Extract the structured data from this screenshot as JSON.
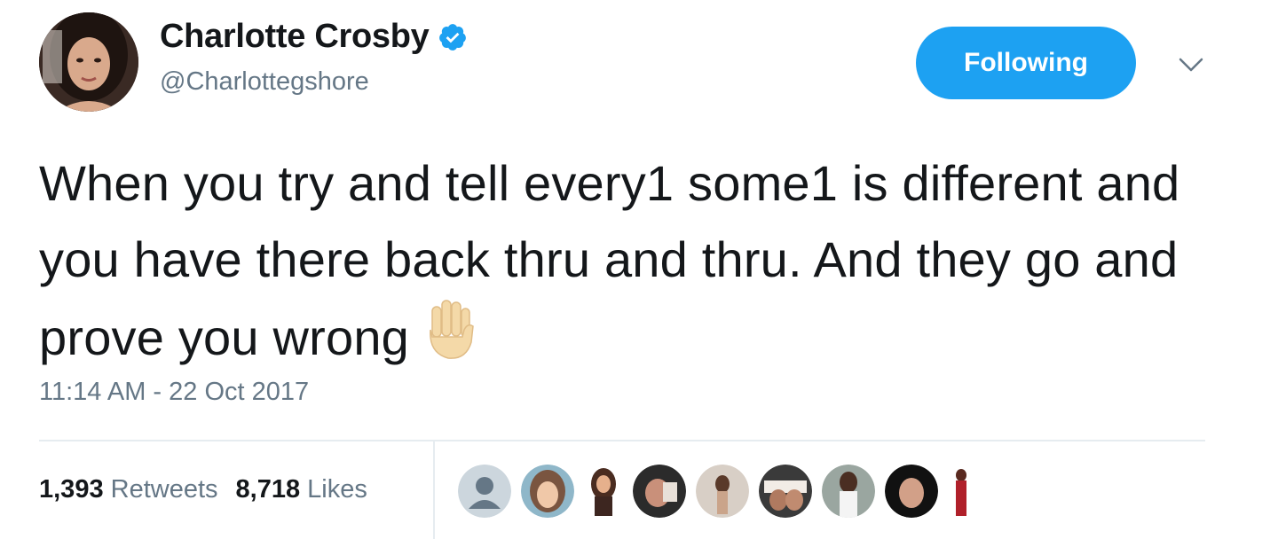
{
  "tweet": {
    "author": {
      "display_name": "Charlotte Crosby",
      "handle": "@Charlottegshore",
      "verified": true,
      "verified_icon": "verified-badge-icon"
    },
    "follow_button_label": "Following",
    "menu_icon": "chevron-down-icon",
    "text": "When you try and tell every1 some1 is different and you have there back thru and thru. And they go and prove you wrong",
    "emoji": "raised-hand-emoji",
    "timestamp": "11:14 AM - 22 Oct 2017",
    "stats": {
      "retweets_count": "1,393",
      "retweets_label": "Retweets",
      "likes_count": "8,718",
      "likes_label": "Likes"
    },
    "liker_avatars_count": 10
  },
  "colors": {
    "accent": "#1da1f2",
    "text_primary": "#14171a",
    "text_secondary": "#657786",
    "divider": "#e6ecf0"
  }
}
